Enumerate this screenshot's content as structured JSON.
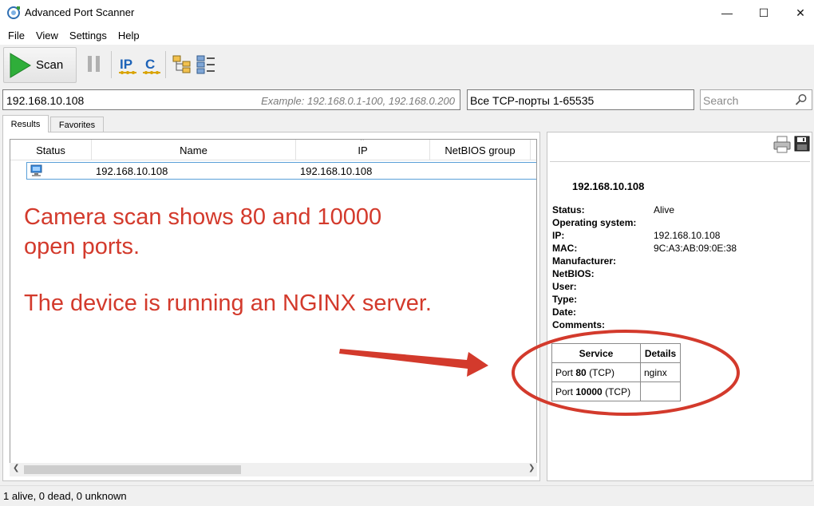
{
  "window": {
    "title": "Advanced Port Scanner"
  },
  "menu": [
    "File",
    "View",
    "Settings",
    "Help"
  ],
  "toolbar": {
    "scan_label": "Scan",
    "ip_icon": "IP",
    "c_icon": "C"
  },
  "inputs": {
    "ip_range": "192.168.10.108",
    "ip_example": "Example: 192.168.0.1-100, 192.168.0.200",
    "ports": "Все TCP-порты 1-65535",
    "search_placeholder": "Search"
  },
  "tabs": [
    "Results",
    "Favorites"
  ],
  "results": {
    "columns": [
      "Status",
      "Name",
      "IP",
      "NetBIOS group"
    ],
    "rows": [
      {
        "name": "192.168.10.108",
        "ip": "192.168.10.108",
        "netbios_group": ""
      }
    ]
  },
  "annotation": {
    "line1": "Camera scan shows 80 and 10000",
    "line2": "open ports.",
    "line3": "The device is running an NGINX server.",
    "color": "#d33a2c"
  },
  "details": {
    "ip": "192.168.10.108",
    "fields": [
      {
        "label": "Status:",
        "value": "Alive"
      },
      {
        "label": "Operating system:",
        "value": ""
      },
      {
        "label": "IP:",
        "value": "192.168.10.108"
      },
      {
        "label": "MAC:",
        "value": "9C:A3:AB:09:0E:38"
      },
      {
        "label": "Manufacturer:",
        "value": ""
      },
      {
        "label": "NetBIOS:",
        "value": ""
      },
      {
        "label": "User:",
        "value": ""
      },
      {
        "label": "Type:",
        "value": ""
      },
      {
        "label": "Date:",
        "value": ""
      },
      {
        "label": "Comments:",
        "value": ""
      }
    ],
    "services_headers": [
      "Service",
      "Details"
    ],
    "services": [
      {
        "prefix": "Port",
        "port": "80",
        "proto": "(TCP)",
        "details": "nginx"
      },
      {
        "prefix": "Port",
        "port": "10000",
        "proto": "(TCP)",
        "details": ""
      }
    ]
  },
  "status": {
    "text": "1 alive, 0 dead, 0 unknown"
  }
}
